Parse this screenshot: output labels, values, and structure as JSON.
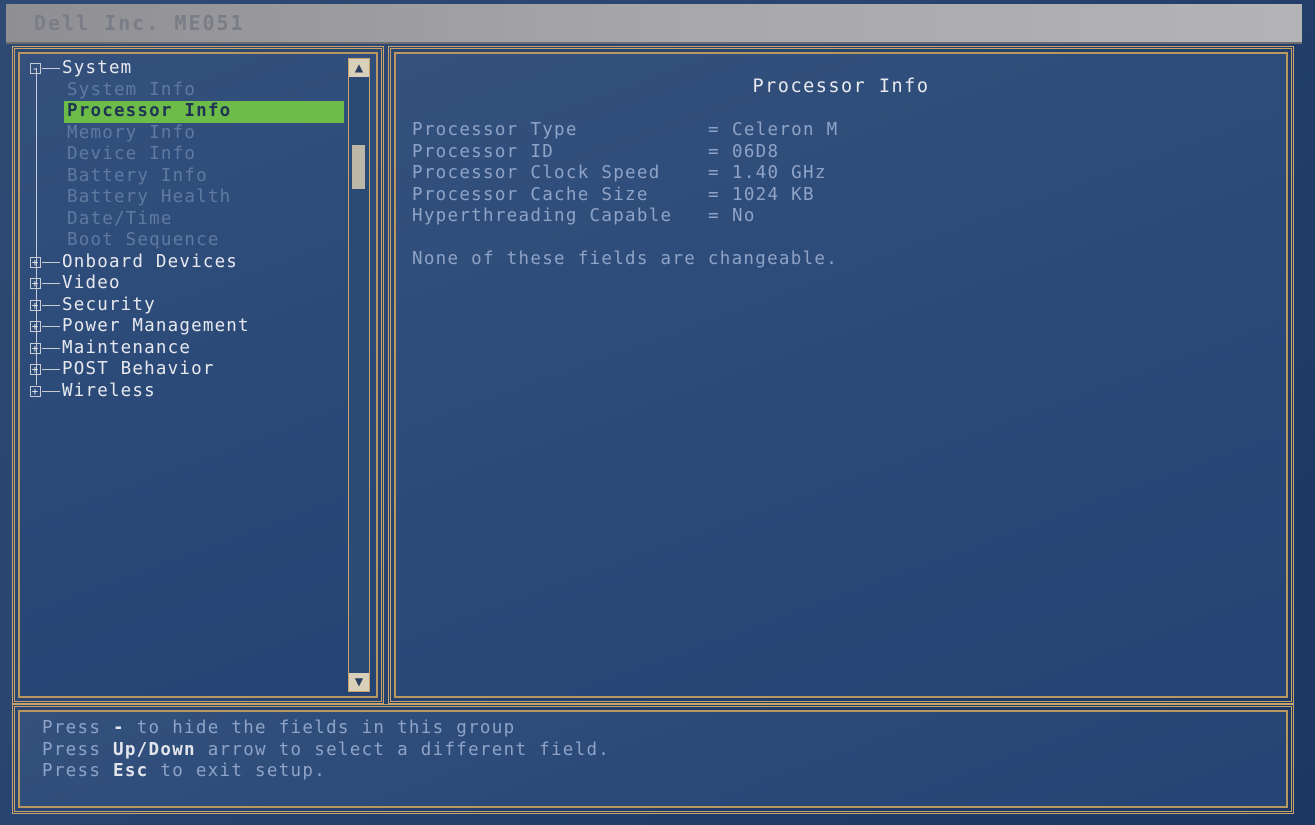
{
  "window": {
    "title": "Dell Inc. ME051"
  },
  "tree": {
    "system_label": "System",
    "system_expander": "-",
    "system_children": [
      {
        "label": "System Info",
        "selected": false
      },
      {
        "label": "Processor Info",
        "selected": true
      },
      {
        "label": "Memory Info",
        "selected": false
      },
      {
        "label": "Device Info",
        "selected": false
      },
      {
        "label": "Battery Info",
        "selected": false
      },
      {
        "label": "Battery Health",
        "selected": false
      },
      {
        "label": "Date/Time",
        "selected": false
      },
      {
        "label": "Boot Sequence",
        "selected": false
      }
    ],
    "groups": [
      {
        "label": "Onboard Devices",
        "expander": "+"
      },
      {
        "label": "Video",
        "expander": "+"
      },
      {
        "label": "Security",
        "expander": "+"
      },
      {
        "label": "Power Management",
        "expander": "+"
      },
      {
        "label": "Maintenance",
        "expander": "+"
      },
      {
        "label": "POST Behavior",
        "expander": "+"
      },
      {
        "label": "Wireless",
        "expander": "+"
      }
    ]
  },
  "scrollbar": {
    "up_icon": "up-arrow-icon",
    "down_icon": "down-arrow-icon"
  },
  "detail": {
    "title": "Processor Info",
    "fields": [
      {
        "name": "Processor Type",
        "value": "Celeron M"
      },
      {
        "name": "Processor ID",
        "value": "06D8"
      },
      {
        "name": "Processor Clock Speed",
        "value": "1.40 GHz"
      },
      {
        "name": "Processor Cache Size",
        "value": "1024 KB"
      },
      {
        "name": "Hyperthreading Capable",
        "value": "No"
      }
    ],
    "equals": "=",
    "note": "None of these fields are changeable."
  },
  "help": {
    "line1": {
      "pre": "Press ",
      "key": "-",
      "post": " to hide the fields in this group"
    },
    "line2": {
      "pre": "Press ",
      "key": "Up/Down",
      "post": " arrow to select a different field."
    },
    "line3": {
      "pre": "Press ",
      "key": "Esc",
      "post": " to exit setup."
    }
  },
  "colors": {
    "background": "#284470",
    "border": "#c9a36a",
    "selection": "#6dbb49",
    "bright_text": "#e6e8ee",
    "dim_text": "#8ea3c6",
    "disabled_text": "#5f7aa0"
  }
}
